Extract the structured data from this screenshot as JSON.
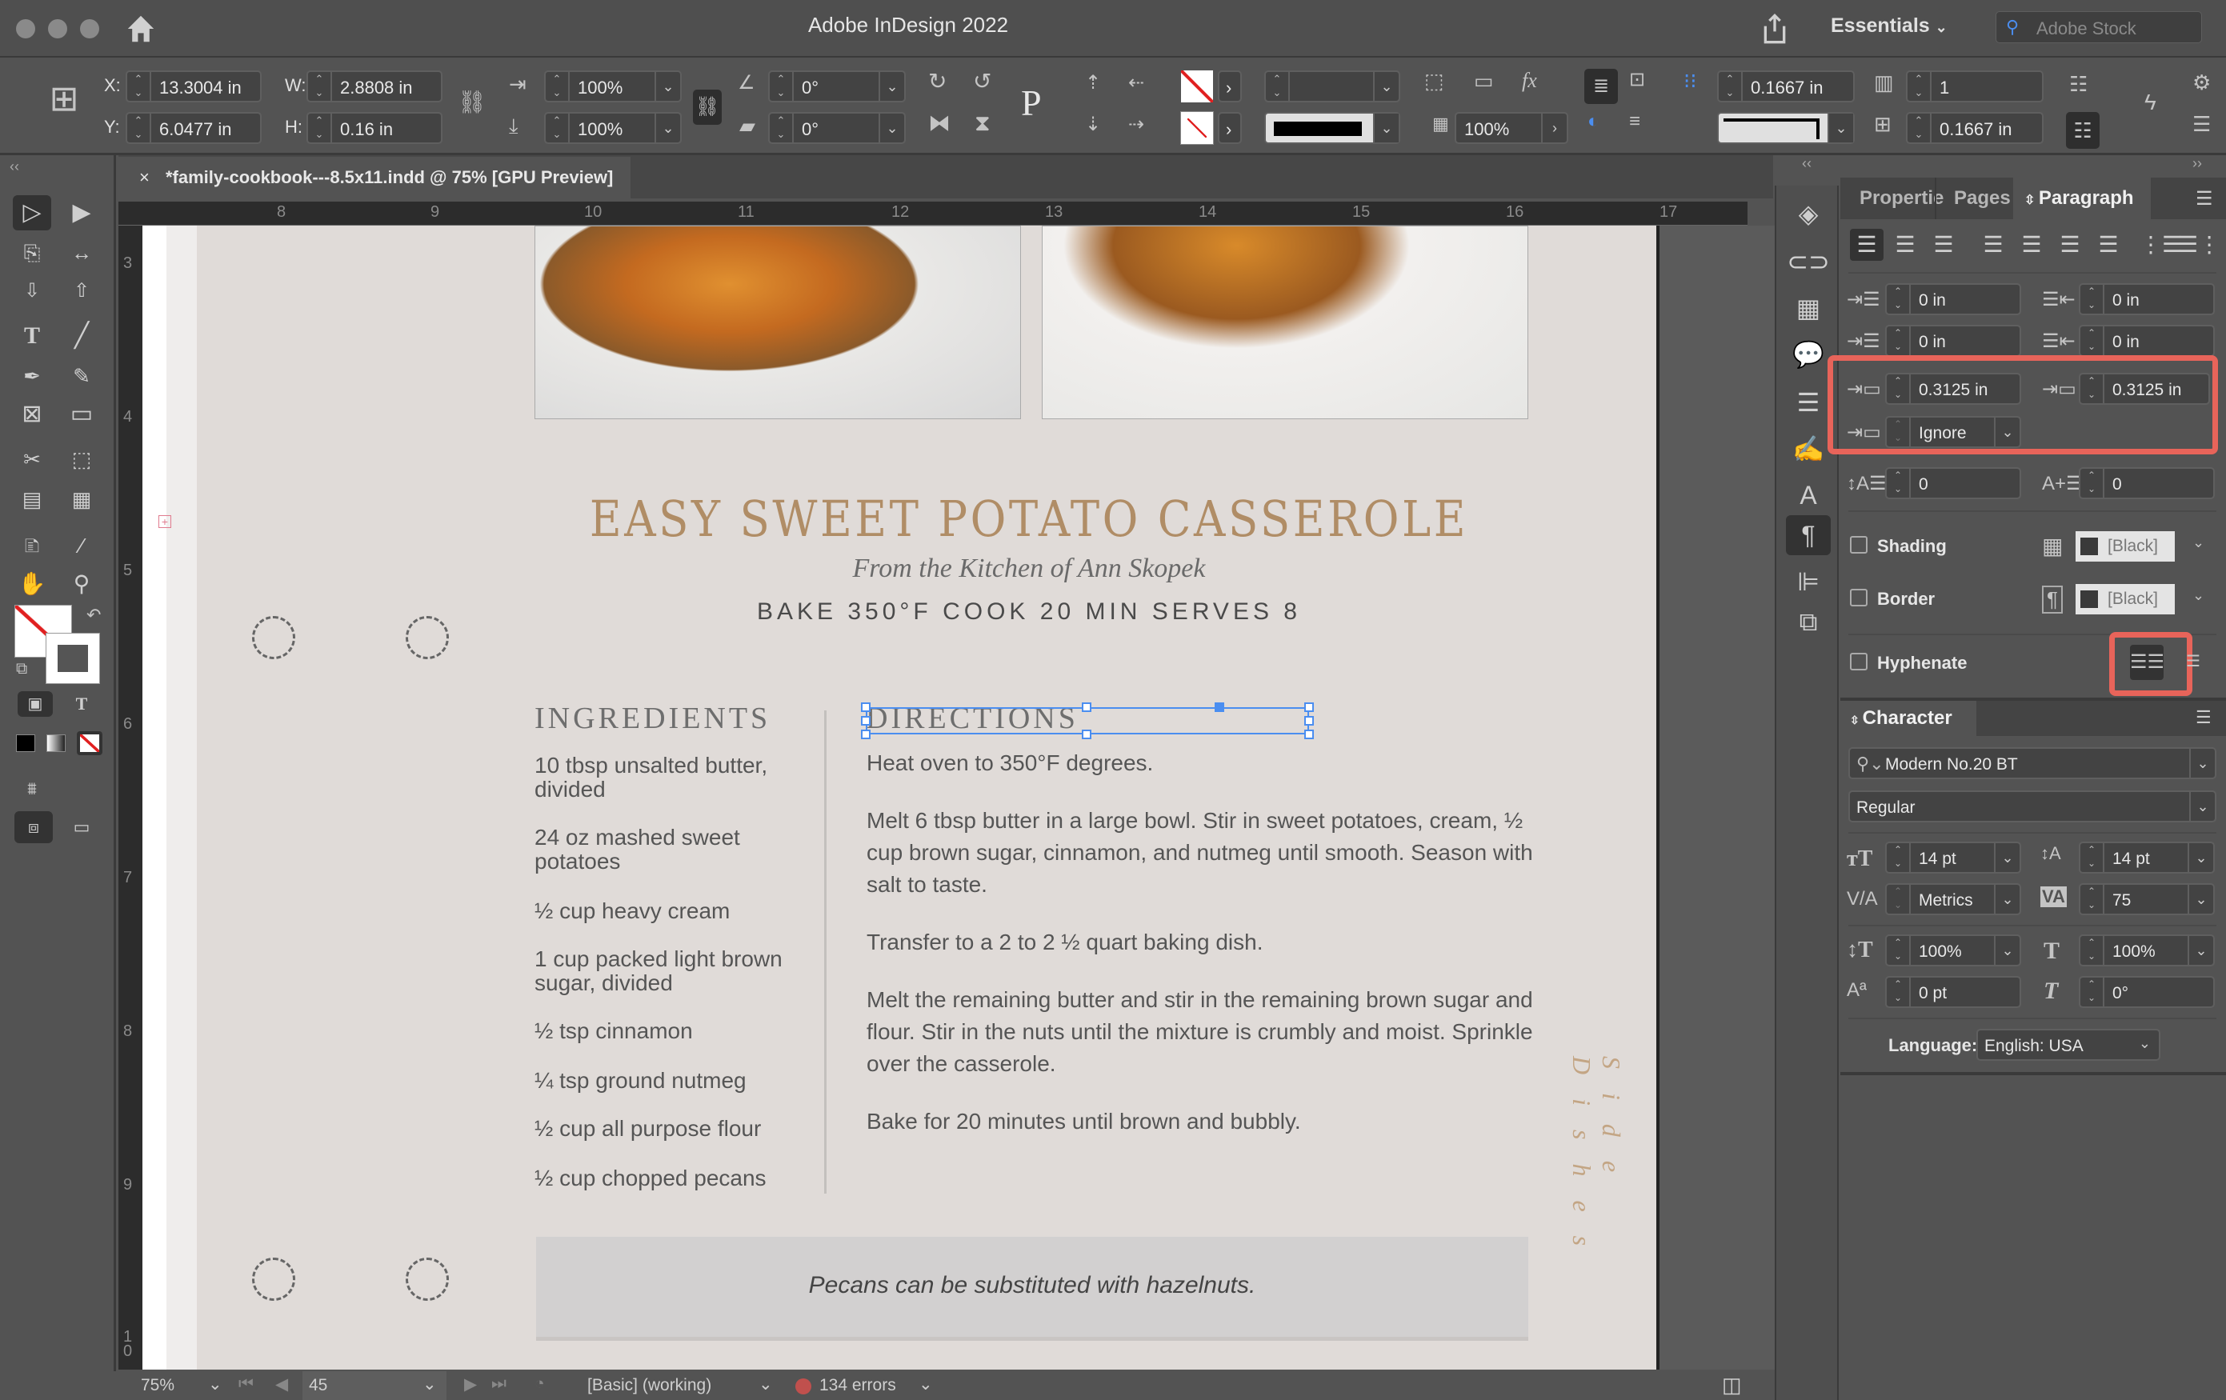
{
  "app": {
    "title": "Adobe InDesign 2022",
    "workspace": "Essentials",
    "stock_search_placeholder": "Adobe Stock"
  },
  "control_bar": {
    "x": "13.3004 in",
    "y": "6.0477 in",
    "w": "2.8808 in",
    "h": "0.16 in",
    "x_label": "X:",
    "y_label": "Y:",
    "w_label": "W:",
    "h_label": "H:",
    "scale_x": "100%",
    "scale_y": "100%",
    "rotate": "0°",
    "shear": "0°",
    "stroke_weight": "",
    "opacity": "100%",
    "gutter": "0.1667 in",
    "columns": "1",
    "column_gutter": "0.1667 in"
  },
  "document_tab": {
    "close": "×",
    "label": "*family-cookbook---8.5x11.indd @ 75% [GPU Preview]"
  },
  "rulers": {
    "horizontal": [
      "8",
      "9",
      "10",
      "11",
      "12",
      "13",
      "14",
      "15",
      "16",
      "17"
    ],
    "vertical": [
      "3",
      "4",
      "5",
      "6",
      "7",
      "8",
      "9",
      "1\n0"
    ]
  },
  "page": {
    "title": "EASY SWEET POTATO CASSEROLE",
    "subtitle": "From the Kitchen of Ann Skopek",
    "meta": "BAKE 350°F   COOK 20 MIN   SERVES 8",
    "ingredients_heading": "INGREDIENTS",
    "ingredients": [
      "10 tbsp unsalted butter, divided",
      "24 oz mashed sweet potatoes",
      "½ cup heavy cream",
      "1 cup packed light brown sugar, divided",
      "½ tsp cinnamon",
      "¼ tsp ground nutmeg",
      "½ cup all purpose flour",
      "½ cup chopped pecans"
    ],
    "directions_heading": "DIRECTIONS",
    "directions": [
      "Heat oven to 350°F degrees.",
      "Melt 6 tbsp butter in a large bowl. Stir in sweet potatoes, cream, ½ cup brown sugar, cinnamon, and nutmeg until smooth. Season with salt to taste.",
      "Transfer to a 2 to 2 ½ quart baking dish.",
      "Melt the remaining butter and stir in the remaining brown sugar and flour. Stir in the nuts until the mixture is crumbly and moist. Sprinkle over the casserole.",
      "Bake for 20 minutes until brown and bubbly."
    ],
    "note": "Pecans can be substituted with hazelnuts.",
    "side_label": "Side Dishes",
    "images": [
      "casserole-dish-photo",
      "casserole-plate-photo"
    ]
  },
  "status_bar": {
    "zoom": "75%",
    "page": "45",
    "preflight_profile": "[Basic] (working)",
    "errors": "134 errors",
    "error_color": "#c0504d"
  },
  "panel_tabs": [
    "Propertie",
    "Pages",
    "Paragraph"
  ],
  "paragraph": {
    "left_indent": "0 in",
    "right_indent": "0 in",
    "first_line_indent": "0 in",
    "last_line_indent": "0 in",
    "space_before": "0.3125 in",
    "space_after": "0.3125 in",
    "align_to_grid": "Ignore",
    "drop_cap_lines": "0",
    "drop_cap_chars": "0",
    "shading_label": "Shading",
    "shading_color": "[Black]",
    "border_label": "Border",
    "border_color": "[Black]",
    "hyphenate_label": "Hyphenate",
    "highlight_color": "#e8645a"
  },
  "character": {
    "title": "Character",
    "font": "Modern No.20 BT",
    "style": "Regular",
    "size": "14 pt",
    "leading": "14 pt",
    "kerning": "Metrics",
    "tracking": "75",
    "vertical_scale": "100%",
    "horizontal_scale": "100%",
    "baseline_shift": "0 pt",
    "skew": "0°",
    "language_label": "Language:",
    "language": "English: USA"
  }
}
